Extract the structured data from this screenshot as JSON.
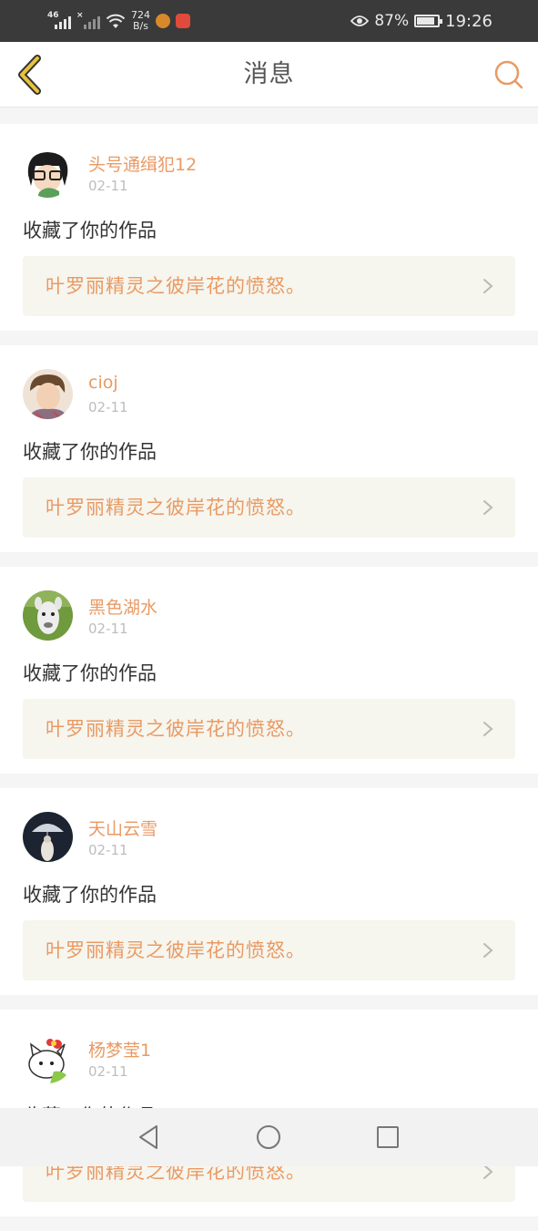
{
  "status_bar": {
    "signal_1": "46",
    "signal_2": "×",
    "speed_value": "724",
    "speed_unit": "B/s",
    "battery": "87%",
    "time": "19:26"
  },
  "header": {
    "title": "消息"
  },
  "colors": {
    "accent": "#e99a63",
    "chevron": "#c9a13a"
  },
  "messages": [
    {
      "user": "头号通缉犯12",
      "date": "02-11",
      "action": "收藏了你的作品",
      "work": "叶罗丽精灵之彼岸花的愤怒。",
      "avatar": "cartoon-girl-avatar"
    },
    {
      "user": "cioj",
      "date": "02-11",
      "action": "收藏了你的作品",
      "work": "叶罗丽精灵之彼岸花的愤怒。",
      "avatar": "boy-photo-avatar"
    },
    {
      "user": "黑色湖水",
      "date": "02-11",
      "action": "收藏了你的作品",
      "work": "叶罗丽精灵之彼岸花的愤怒。",
      "avatar": "alpaca-avatar"
    },
    {
      "user": "天山云雪",
      "date": "02-11",
      "action": "收藏了你的作品",
      "work": "叶罗丽精灵之彼岸花的愤怒。",
      "avatar": "umbrella-night-avatar"
    },
    {
      "user": "杨梦莹1",
      "date": "02-11",
      "action": "收藏了你的作品",
      "work": "叶罗丽精灵之彼岸花的愤怒。",
      "avatar": "hello-kitty-avatar"
    }
  ]
}
